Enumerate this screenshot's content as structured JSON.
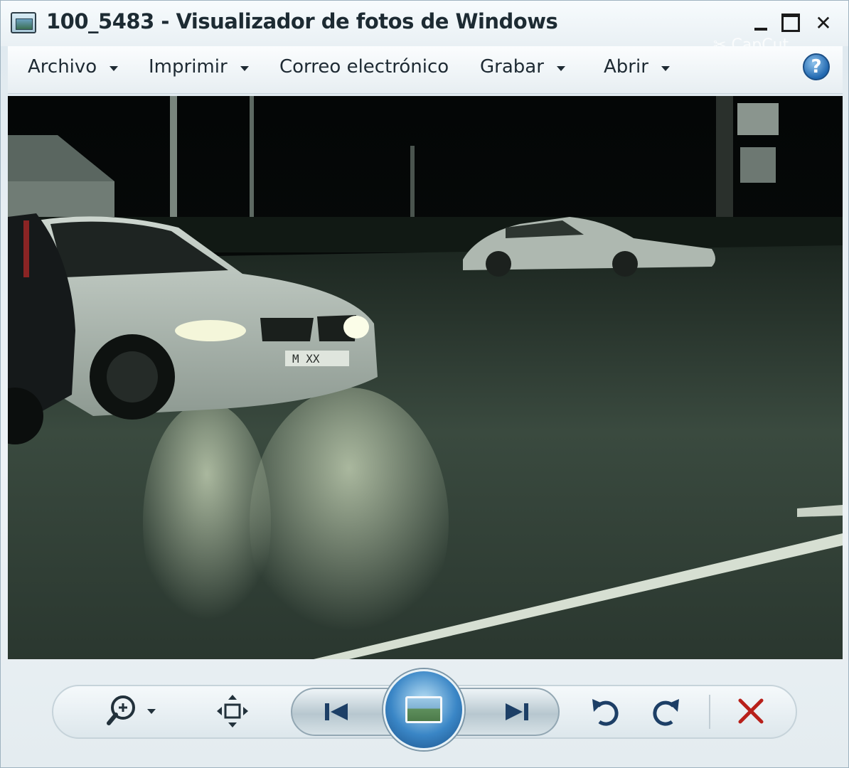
{
  "window": {
    "title": "100_5483 - Visualizador de fotos de Windows",
    "watermark": "CapCut"
  },
  "menu": {
    "items": [
      {
        "label": "Archivo",
        "has_dropdown": true
      },
      {
        "label": "Imprimir",
        "has_dropdown": true
      },
      {
        "label": "Correo electrónico",
        "has_dropdown": false
      },
      {
        "label": "Grabar",
        "has_dropdown": true
      },
      {
        "label": "Abrir",
        "has_dropdown": true
      }
    ],
    "help_icon": "help-icon",
    "help_glyph": "?"
  },
  "photo": {
    "description_icon": "photo-image",
    "plate_text": "M XX"
  },
  "toolbar": {
    "zoom_icon": "zoom-icon",
    "fit_icon": "actual-size-icon",
    "prev_icon": "previous-icon",
    "slideshow_icon": "slideshow-icon",
    "next_icon": "next-icon",
    "rotate_left_icon": "rotate-counterclockwise-icon",
    "rotate_right_icon": "rotate-clockwise-icon",
    "delete_icon": "delete-icon",
    "delete_color": "#b8201a"
  },
  "window_buttons": {
    "minimize": "minimize-icon",
    "maximize": "maximize-icon",
    "close": "close-icon",
    "close_glyph": "✕"
  }
}
